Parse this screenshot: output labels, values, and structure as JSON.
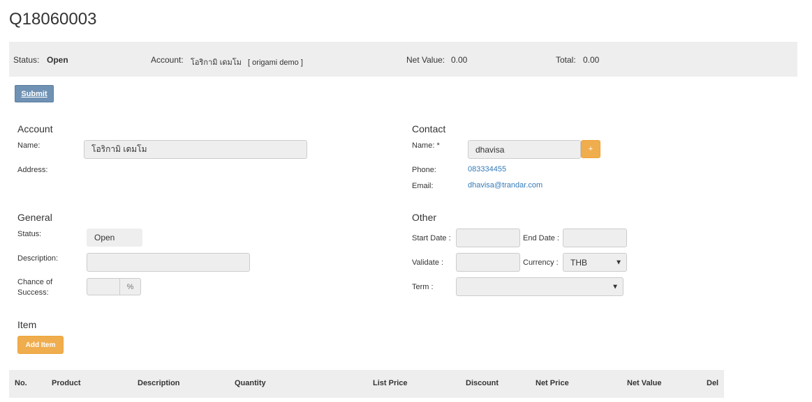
{
  "page": {
    "title": "Q18060003"
  },
  "summary": {
    "status_label": "Status:",
    "status_value": "Open",
    "account_label": "Account:",
    "account_value": "โอริกามิ เดมโม   [ origami demo ]",
    "net_value_label": "Net Value:",
    "net_value": "0.00",
    "total_label": "Total:",
    "total_value": "0.00"
  },
  "toolbar": {
    "submit_label": "Submit"
  },
  "account": {
    "title": "Account",
    "name_label": "Name:",
    "name_value": "โอริกามิ เดมโม",
    "address_label": "Address:"
  },
  "contact": {
    "title": "Contact",
    "name_label": "Name: *",
    "name_value": "dhavisa",
    "add_label": "+",
    "phone_label": "Phone:",
    "phone_value": "083334455",
    "email_label": "Email:",
    "email_value": "dhavisa@trandar.com"
  },
  "general": {
    "title": "General",
    "status_label": "Status:",
    "status_value": "Open",
    "description_label": "Description:",
    "description_value": "",
    "chance_label_1": "Chance of",
    "chance_label_2": "Success:",
    "chance_value": "",
    "chance_unit": "%"
  },
  "other": {
    "title": "Other",
    "start_date_label": "Start Date :",
    "start_date_value": "",
    "end_date_label": "End Date :",
    "end_date_value": "",
    "validate_label": "Validate :",
    "validate_value": "",
    "currency_label": "Currency :",
    "currency_value": "THB",
    "term_label": "Term :",
    "term_value": ""
  },
  "item": {
    "title": "Item",
    "add_label": "Add Item",
    "columns": [
      "No.",
      "Product",
      "Description",
      "Quantity",
      "List Price",
      "Discount",
      "Net Price",
      "Net Value",
      "Del"
    ]
  },
  "colors": {
    "primary_button": "#6f91b3",
    "warning_button": "#f0ad4e",
    "link": "#337ab7",
    "panel_bg": "#eeeeee"
  },
  "icons": {
    "select_caret": "caret-down-icon"
  }
}
